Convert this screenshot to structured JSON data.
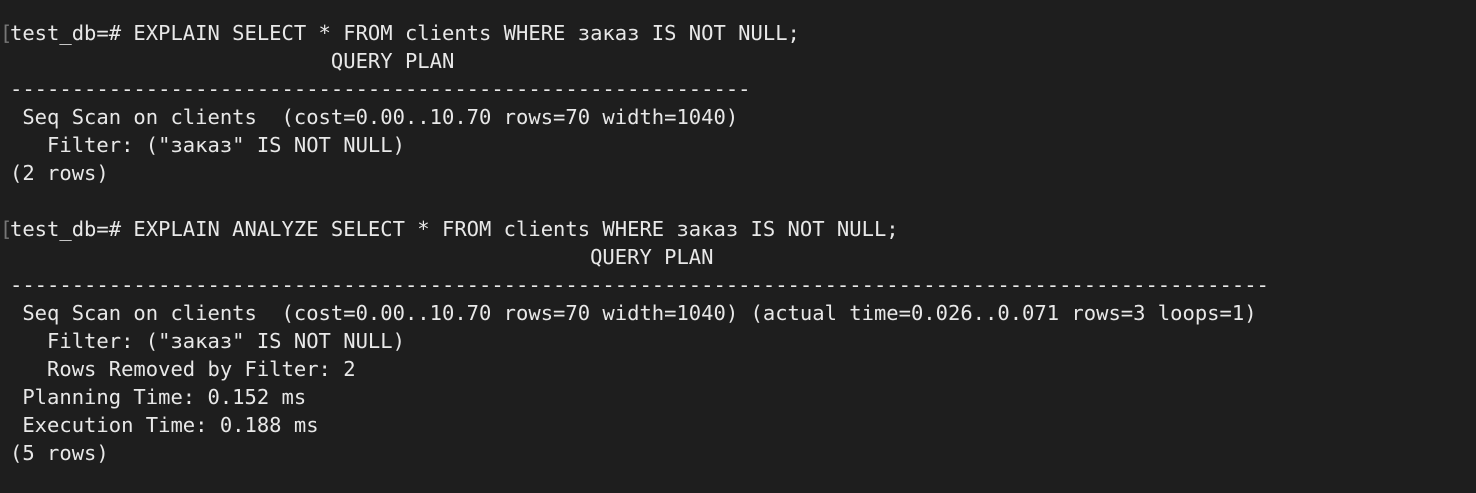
{
  "theme": {
    "background": "#1e1e1e",
    "foreground": "#e8e8e8",
    "marker": "#777777"
  },
  "session": {
    "blocks": [
      {
        "lines": [
          {
            "marker": "[",
            "text": "test_db=# EXPLAIN SELECT * FROM clients WHERE заказ IS NOT NULL;"
          },
          {
            "marker": "",
            "text": "                          QUERY PLAN"
          },
          {
            "marker": "",
            "text": "------------------------------------------------------------"
          },
          {
            "marker": "",
            "text": " Seq Scan on clients  (cost=0.00..10.70 rows=70 width=1040)"
          },
          {
            "marker": "",
            "text": "   Filter: (\"заказ\" IS NOT NULL)"
          },
          {
            "marker": "",
            "text": "(2 rows)"
          },
          {
            "marker": "",
            "text": ""
          }
        ]
      },
      {
        "lines": [
          {
            "marker": "[",
            "text": "test_db=# EXPLAIN ANALYZE SELECT * FROM clients WHERE заказ IS NOT NULL;"
          },
          {
            "marker": "",
            "text": "                                               QUERY PLAN"
          },
          {
            "marker": "",
            "text": "------------------------------------------------------------------------------------------------------"
          },
          {
            "marker": "",
            "text": " Seq Scan on clients  (cost=0.00..10.70 rows=70 width=1040) (actual time=0.026..0.071 rows=3 loops=1)"
          },
          {
            "marker": "",
            "text": "   Filter: (\"заказ\" IS NOT NULL)"
          },
          {
            "marker": "",
            "text": "   Rows Removed by Filter: 2"
          },
          {
            "marker": "",
            "text": " Planning Time: 0.152 ms"
          },
          {
            "marker": "",
            "text": " Execution Time: 0.188 ms"
          },
          {
            "marker": "",
            "text": "(5 rows)"
          }
        ]
      }
    ]
  }
}
